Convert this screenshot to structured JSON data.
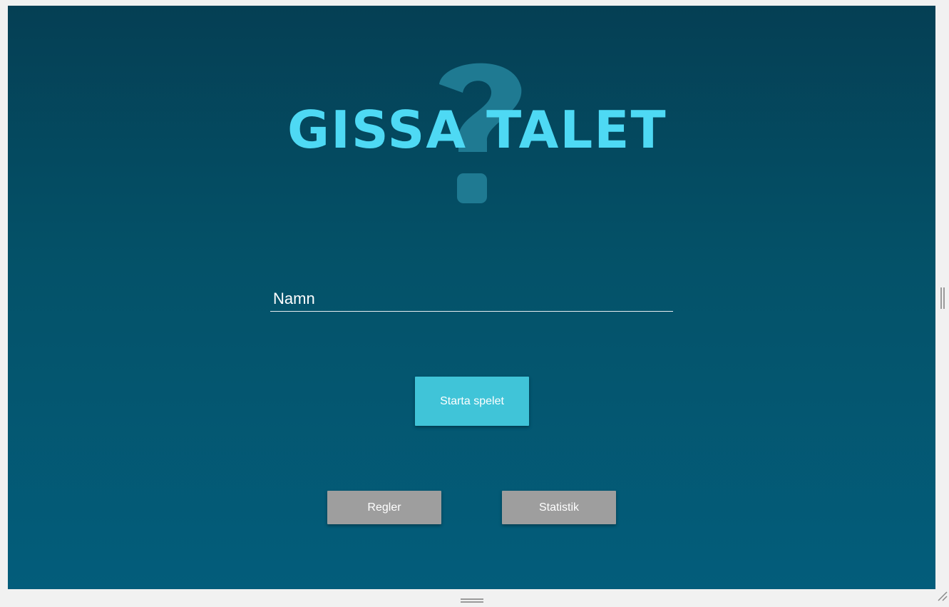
{
  "app": {
    "logo_text": "GISSA TALET"
  },
  "form": {
    "name_placeholder": "Namn",
    "name_value": ""
  },
  "buttons": {
    "start_label": "Starta spelet",
    "rules_label": "Regler",
    "stats_label": "Statistik"
  },
  "colors": {
    "background_top": "#053f54",
    "background_bottom": "#035d7b",
    "logo_text": "#4ed9f4",
    "question_mark": "#1f7a92",
    "start_button": "#40c4d8",
    "secondary_button": "#9e9e9e"
  },
  "icons": {
    "logo_background": "question-mark-icon",
    "right_resize": "resize-handle-icon",
    "bottom_resize": "resize-handle-icon",
    "corner_resize": "resize-grip-icon"
  }
}
